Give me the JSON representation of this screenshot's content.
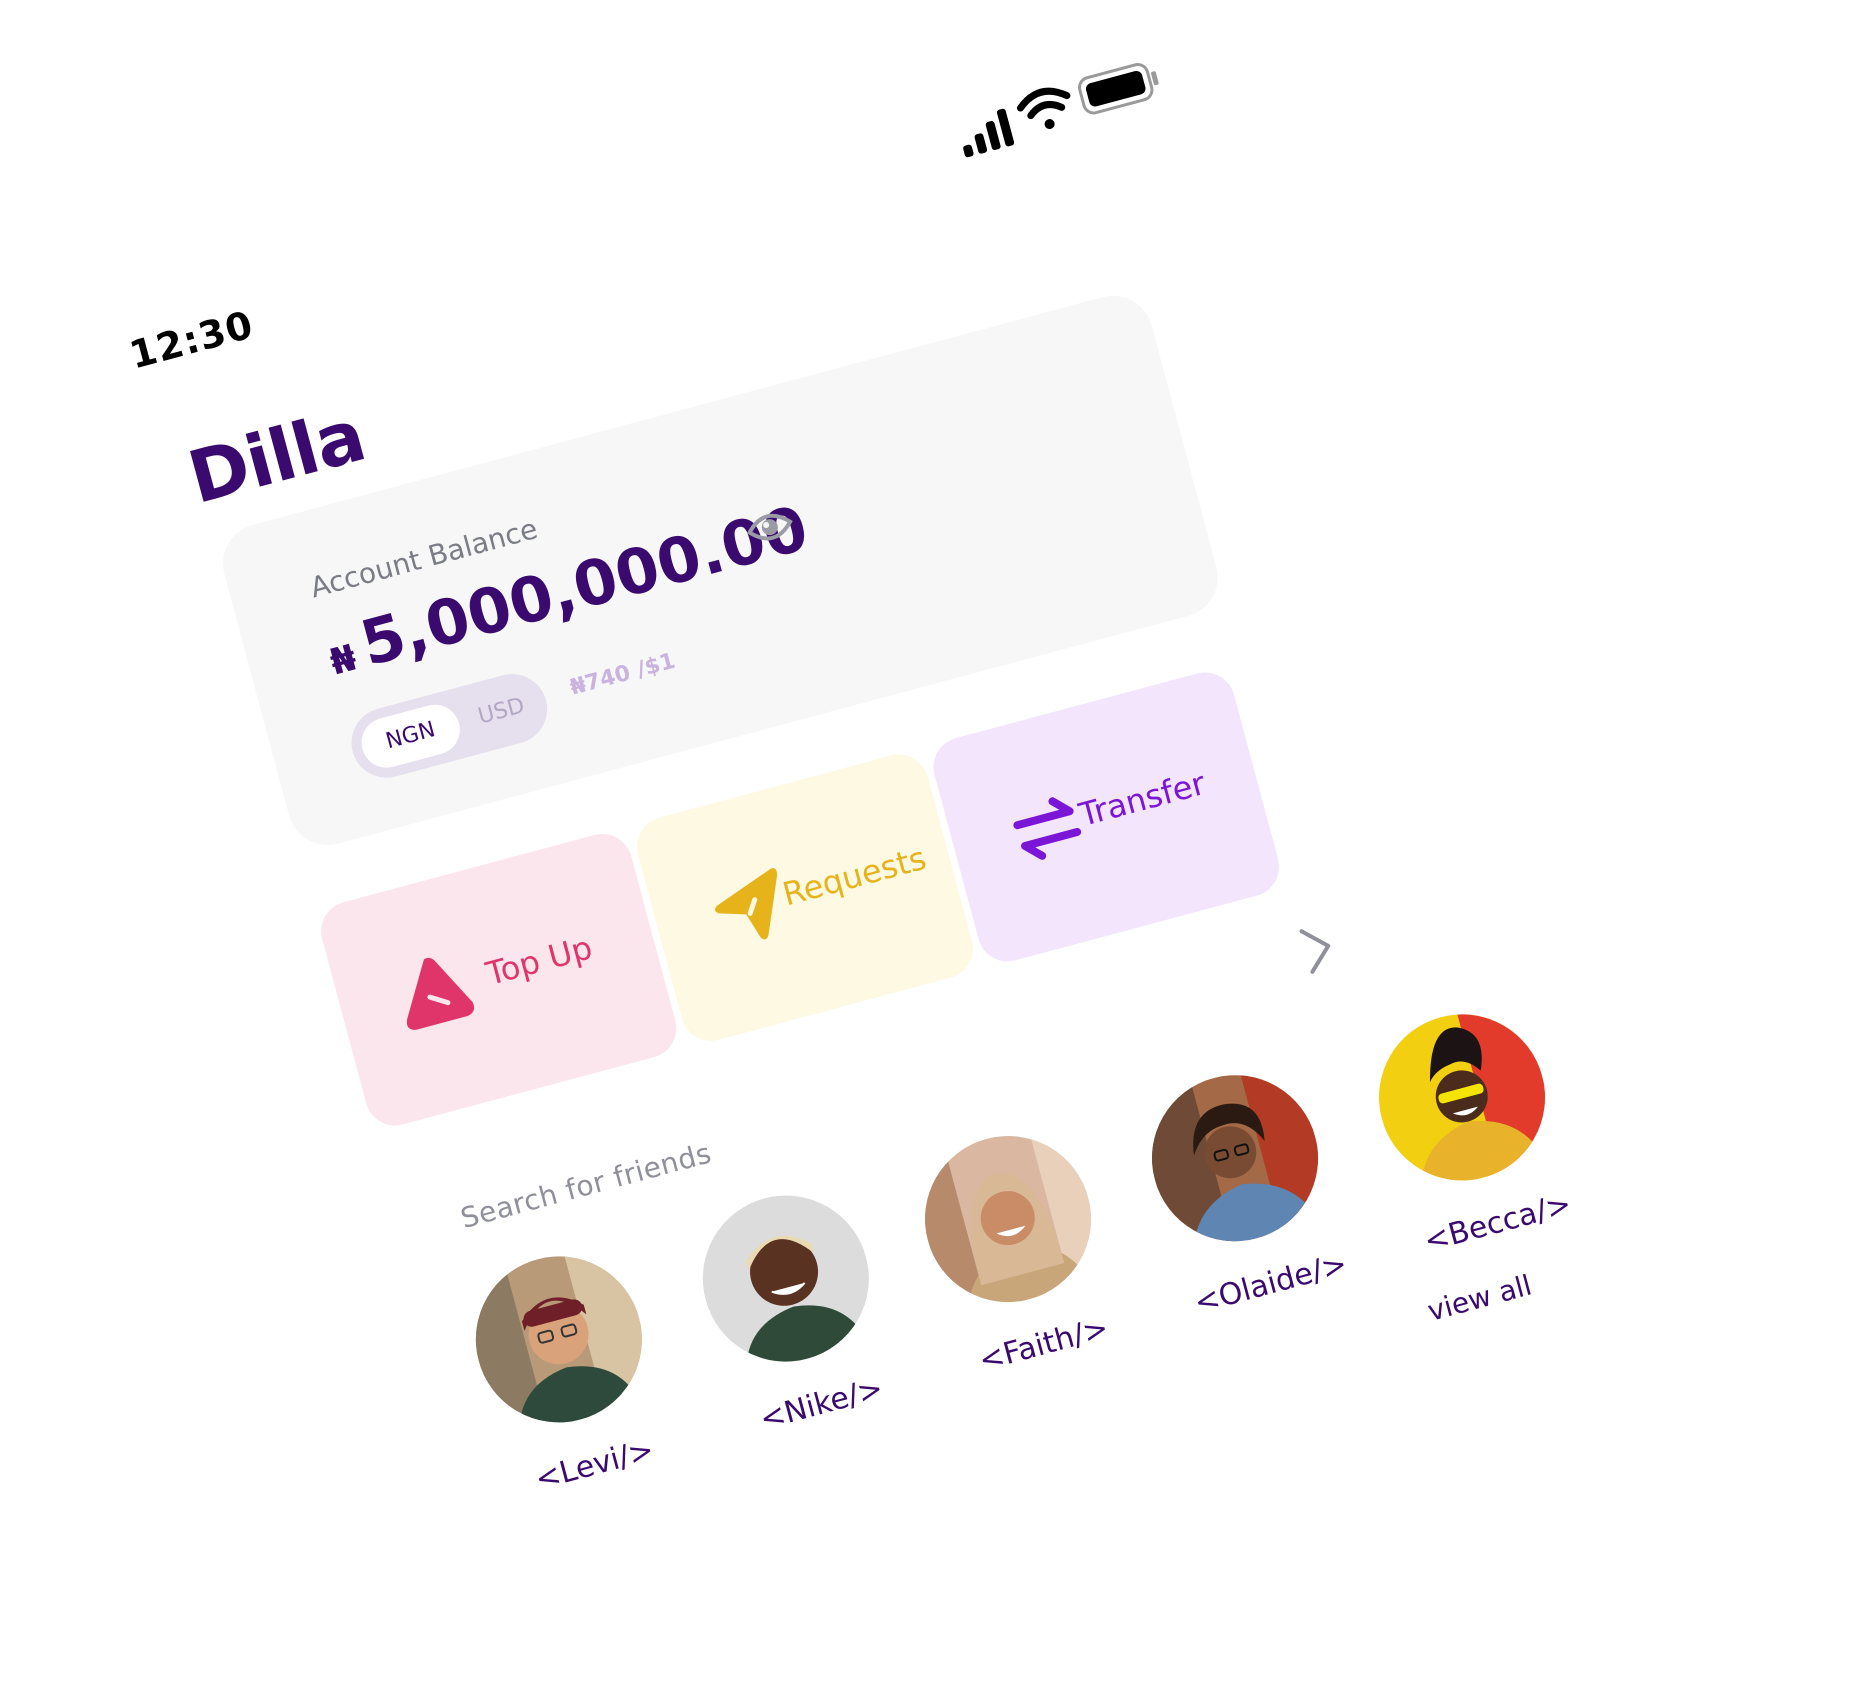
{
  "status_bar": {
    "time": "12:30",
    "signal_icon": "cellular-signal-icon",
    "wifi_icon": "wifi-icon",
    "battery_icon": "battery-icon"
  },
  "app": {
    "brand": "Dilla"
  },
  "balance": {
    "label": "Account Balance",
    "currency_symbol": "₦",
    "amount": "5,000,000.00",
    "visibility_icon": "eye-icon",
    "toggle": {
      "selected": "NGN",
      "other": "USD"
    },
    "rate": "₦740 /$1"
  },
  "actions": {
    "top_up": "Top Up",
    "requests": "Requests",
    "transfer": "Transfer"
  },
  "friends": {
    "search_placeholder": "Search for friends",
    "list": [
      {
        "name": "<Levi/>"
      },
      {
        "name": "<Nike/>"
      },
      {
        "name": "<Faith/>"
      },
      {
        "name": "<Olaide/>"
      },
      {
        "name": "<Becca/>"
      }
    ],
    "view_all": "view all"
  },
  "colors": {
    "brand": "#3a0a6e",
    "top_up": "#e0356a",
    "requests": "#e6b31a",
    "transfer": "#7b16d6"
  }
}
